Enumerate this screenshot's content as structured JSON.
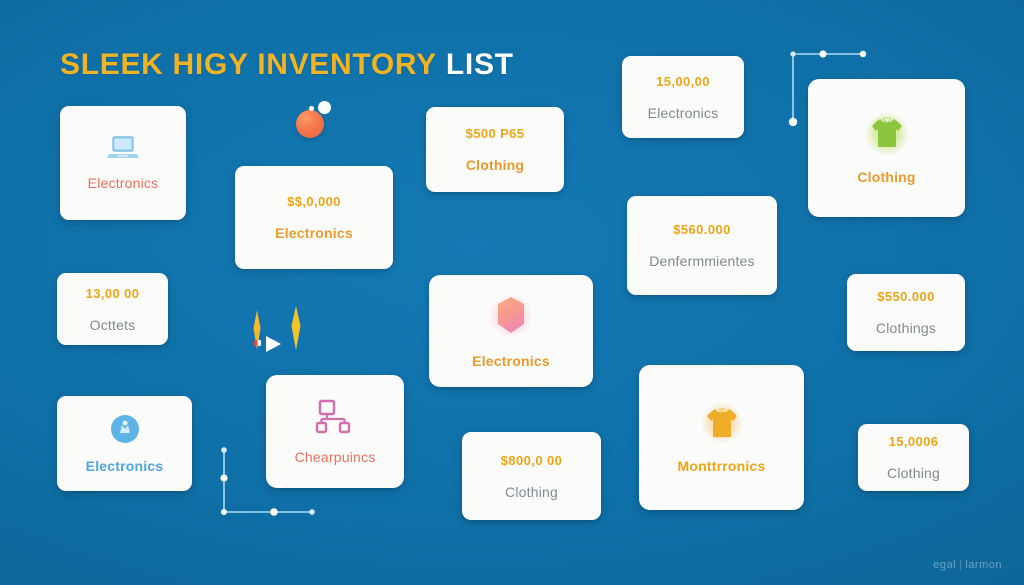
{
  "header": {
    "title_highlight": "SLEEK HIGY INVENTORY",
    "title_rest": "LIST"
  },
  "colors": {
    "background": "#1173ab",
    "title_gold": "#f0b323",
    "title_white": "#ffffff",
    "amount_gold": "#eba517",
    "card_bg": "#fbfbfa",
    "label_gray": "#808a90",
    "label_orange": "#e89b2c",
    "label_salmon": "#e8705e",
    "label_blue": "#4ea6dd",
    "accent_sphere": "#f4774a",
    "accent_green": "#8cc63f",
    "accent_pink": "#d66fb0",
    "line_blue": "#9fd4ef"
  },
  "cards": [
    {
      "id": "card-electronics-laptop",
      "icon": "laptop-icon",
      "amount": "",
      "label": "Electronics",
      "label_color": "salmon"
    },
    {
      "id": "card-electronics-amount",
      "icon": "",
      "amount": "$$,0,000",
      "label": "Electronics",
      "label_color": "orange"
    },
    {
      "id": "card-clothing-500",
      "icon": "",
      "amount": "$500 P65",
      "label": "Clothing",
      "label_color": "orange"
    },
    {
      "id": "card-electronics-150000",
      "icon": "",
      "amount": "15,00,00",
      "label": "Electronics",
      "label_color": "gray"
    },
    {
      "id": "card-clothing-shirt-green",
      "icon": "tshirt-green-icon",
      "amount": "",
      "label": "Clothing",
      "label_color": "orange"
    },
    {
      "id": "card-octtets",
      "icon": "",
      "amount": "13,00 00",
      "label": "Octtets",
      "label_color": "gray"
    },
    {
      "id": "card-denfermmientes",
      "icon": "",
      "amount": "$560.000",
      "label": "Denfermmientes",
      "label_color": "gray"
    },
    {
      "id": "card-electronics-hexagon",
      "icon": "hexagon-gradient-icon",
      "amount": "",
      "label": "Electronics",
      "label_color": "orange"
    },
    {
      "id": "card-clothings-550",
      "icon": "",
      "amount": "$550.000",
      "label": "Clothings",
      "label_color": "gray"
    },
    {
      "id": "card-electronics-circle",
      "icon": "circle-badge-icon",
      "amount": "",
      "label": "Electronics",
      "label_color": "blue"
    },
    {
      "id": "card-chearpuincs",
      "icon": "network-diagram-icon",
      "amount": "",
      "label": "Chearpuincs",
      "label_color": "salmon"
    },
    {
      "id": "card-clothing-800",
      "icon": "",
      "amount": "$800,0 00",
      "label": "Clothing",
      "label_color": "gray"
    },
    {
      "id": "card-monttrronics",
      "icon": "tshirt-orange-icon",
      "amount": "",
      "label": "Monttrronics",
      "label_color": "gold"
    },
    {
      "id": "card-clothing-150006",
      "icon": "",
      "amount": "15,0006",
      "label": "Clothing",
      "label_color": "gray"
    }
  ],
  "decor": {
    "sphere": "orange-sphere",
    "sparkle_left": "sparkle-icon",
    "sparkle_right": "sparkle-icon",
    "play_triangle": "play-triangle-icon",
    "line_top_right": "connector-line-graphic",
    "line_bottom_left": "axis-line-graphic"
  },
  "footer": {
    "brand": "egal",
    "separator": "|",
    "suffix": "larmon"
  }
}
